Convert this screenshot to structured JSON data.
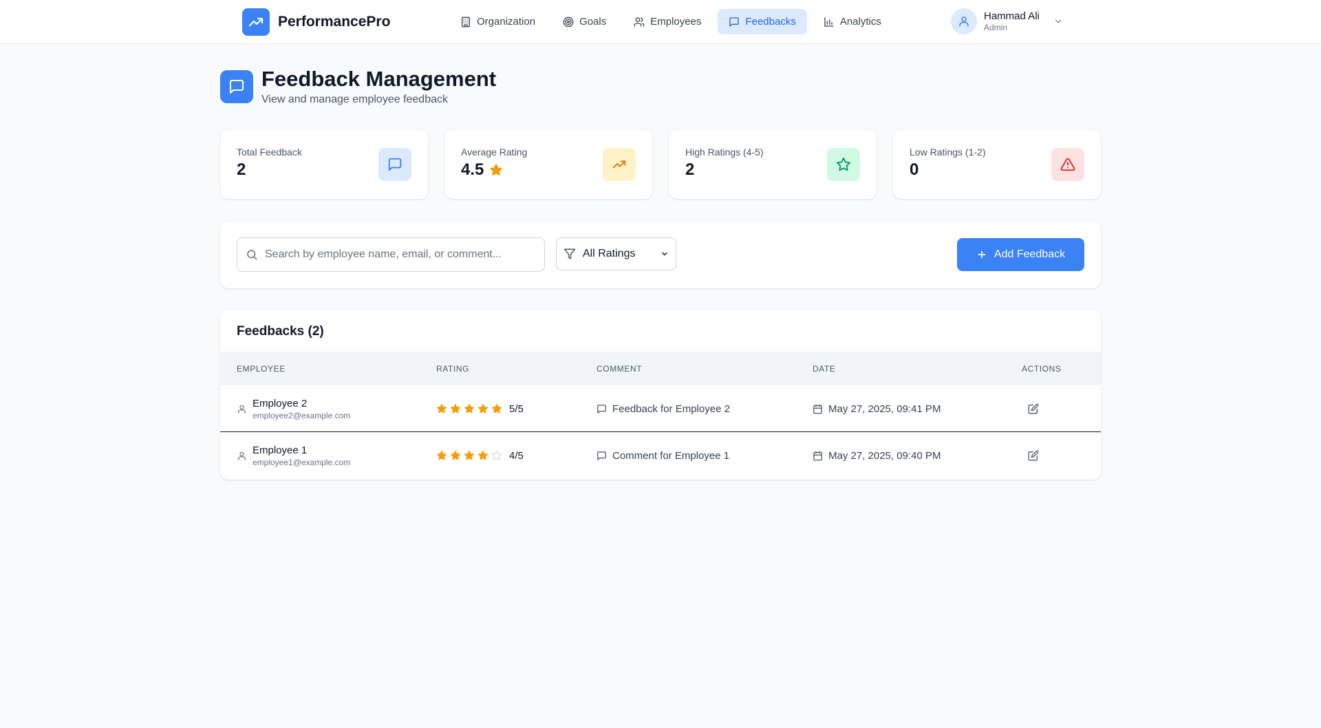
{
  "app": {
    "name": "PerformancePro",
    "brand_color": "#3b82f6"
  },
  "nav": {
    "items": [
      {
        "label": "Organization",
        "icon": "building-icon",
        "active": false
      },
      {
        "label": "Goals",
        "icon": "target-icon",
        "active": false
      },
      {
        "label": "Employees",
        "icon": "users-icon",
        "active": false
      },
      {
        "label": "Feedbacks",
        "icon": "message-icon",
        "active": true
      },
      {
        "label": "Analytics",
        "icon": "bar-chart-icon",
        "active": false
      }
    ]
  },
  "user": {
    "name": "Hammad Ali",
    "role": "Admin"
  },
  "page": {
    "title": "Feedback Management",
    "subtitle": "View and manage employee feedback"
  },
  "stats": [
    {
      "label": "Total Feedback",
      "value": "2",
      "icon": "message-icon",
      "color": "#3b82f6",
      "bg": "#dbeafe"
    },
    {
      "label": "Average Rating",
      "value": "4.5",
      "icon": "trending-up-icon",
      "color": "#d97706",
      "bg": "#fef3c7"
    },
    {
      "label": "High Ratings (4-5)",
      "value": "2",
      "icon": "star-icon",
      "color": "#059669",
      "bg": "#d1fae5"
    },
    {
      "label": "Low Ratings (1-2)",
      "value": "0",
      "icon": "alert-triangle-icon",
      "color": "#dc2626",
      "bg": "#fee2e2"
    }
  ],
  "filters": {
    "search_placeholder": "Search by employee name, email, or comment...",
    "search_value": "",
    "rating_selected": "All Ratings",
    "add_button": "Add Feedback"
  },
  "table": {
    "title": "Feedbacks (2)",
    "columns": [
      "EMPLOYEE",
      "RATING",
      "COMMENT",
      "DATE",
      "ACTIONS"
    ],
    "rows": [
      {
        "name": "Employee 2",
        "email": "employee2@example.com",
        "rating": 5,
        "rating_text": "5/5",
        "comment": "Feedback for Employee 2",
        "date": "May 27, 2025, 09:41 PM"
      },
      {
        "name": "Employee 1",
        "email": "employee1@example.com",
        "rating": 4,
        "rating_text": "4/5",
        "comment": "Comment for Employee 1",
        "date": "May 27, 2025, 09:40 PM"
      }
    ]
  },
  "colors": {
    "star_filled": "#f59e0b",
    "star_empty": "#d1d5db"
  }
}
